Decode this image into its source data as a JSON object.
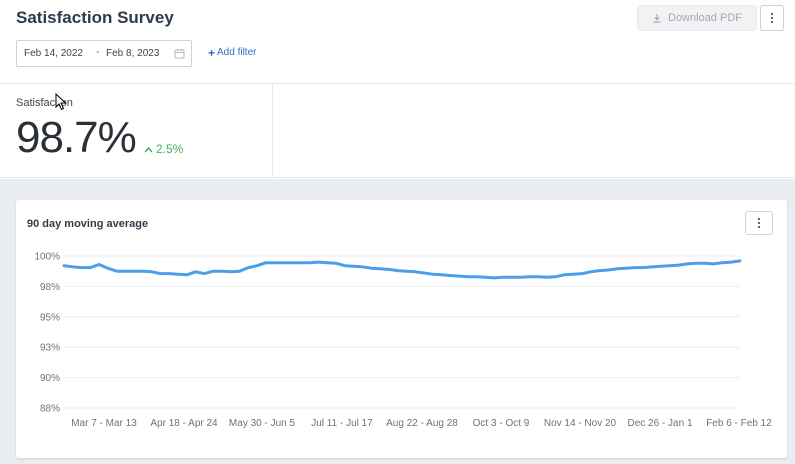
{
  "header": {
    "title": "Satisfaction Survey",
    "download_label": "Download PDF",
    "download_icon": "download-icon",
    "more_icon": "kebab-icon"
  },
  "filters": {
    "start_date": "Feb 14, 2022",
    "separator": "-",
    "end_date": "Feb 8, 2023",
    "calendar_icon": "calendar-icon",
    "add_filter_label": "Add filter"
  },
  "kpi": {
    "label": "Satisfaction",
    "value": "98.7%",
    "change": "2.5%",
    "change_color": "#3bb35b"
  },
  "card": {
    "title": "90 day moving average",
    "more_icon": "kebab-icon"
  },
  "chart_data": {
    "type": "line",
    "title": "90 day moving average",
    "y_ticks": [
      "100%",
      "98%",
      "95%",
      "93%",
      "90%",
      "88%"
    ],
    "ylim": [
      87.5,
      100
    ],
    "x_ticks": [
      "Mar 7 - Mar 13",
      "Apr 18 - Apr 24",
      "May 30 - Jun 5",
      "Jul 11 - Jul 17",
      "Aug 22 - Aug 28",
      "Oct 3 - Oct 9",
      "Nov 14 - Nov 20",
      "Dec 26 - Jan 1",
      "Feb 6 - Feb 12"
    ],
    "grid": true,
    "line_color": "#4a9eea",
    "series": [
      {
        "values": [
          99.2,
          99.1,
          99.05,
          99.05,
          99.3,
          99.0,
          98.75,
          98.75,
          98.75,
          98.75,
          98.7,
          98.55,
          98.55,
          98.5,
          98.45,
          98.7,
          98.55,
          98.75,
          98.75,
          98.7,
          98.75,
          99.05,
          99.2,
          99.45,
          99.45,
          99.45,
          99.45,
          99.45,
          99.45,
          99.5,
          99.45,
          99.4,
          99.2,
          99.15,
          99.1,
          99.0,
          98.95,
          98.9,
          98.8,
          98.75,
          98.7,
          98.6,
          98.5,
          98.45,
          98.4,
          98.35,
          98.3,
          98.3,
          98.25,
          98.2,
          98.25,
          98.25,
          98.25,
          98.3,
          98.3,
          98.25,
          98.3,
          98.45,
          98.5,
          98.55,
          98.7,
          98.8,
          98.85,
          98.95,
          99.0,
          99.05,
          99.05,
          99.1,
          99.15,
          99.2,
          99.25,
          99.35,
          99.4,
          99.4,
          99.35,
          99.45,
          99.5,
          99.6
        ]
      }
    ]
  }
}
